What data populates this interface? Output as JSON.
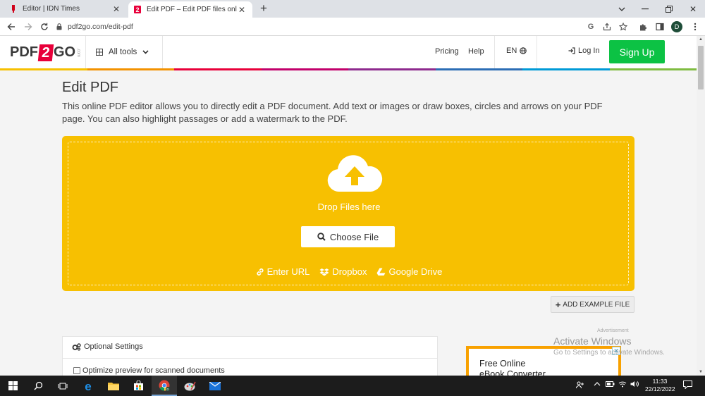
{
  "browser": {
    "tabs": [
      {
        "title": "Editor | IDN Times",
        "favicon": "idn-icon",
        "active": false
      },
      {
        "title": "Edit PDF – Edit PDF files online",
        "favicon": "pdf2go-icon",
        "active": true
      }
    ],
    "url": "pdf2go.com/edit-pdf",
    "profile_initial": "D",
    "google_glyph": "G"
  },
  "site": {
    "logo": {
      "pre": "PDF",
      "mid": "2",
      "post": "GO",
      "suffix": ".com"
    },
    "all_tools": "All tools",
    "nav": {
      "pricing": "Pricing",
      "help": "Help",
      "lang": "EN",
      "login": "Log In",
      "signup": "Sign Up"
    },
    "rainbow": [
      "#f7c001",
      "#f39200",
      "#e8003a",
      "#c2006b",
      "#8e2a8e",
      "#2c6db5",
      "#009ad7",
      "#7fbc41"
    ]
  },
  "main": {
    "title": "Edit PDF",
    "description": "This online PDF editor allows you to directly edit a PDF document. Add text or images or draw boxes, circles and arrows on your PDF page. You can also highlight passages or add a watermark to the PDF.",
    "dropzone": {
      "drop_text": "Drop Files here",
      "choose_file": "Choose File",
      "sources": {
        "url": "Enter URL",
        "dropbox": "Dropbox",
        "gdrive": "Google Drive"
      },
      "color": "#f7c001"
    },
    "example_file": "ADD EXAMPLE FILE",
    "optional_settings": {
      "title": "Optional Settings",
      "option1": "Optimize preview for scanned documents"
    }
  },
  "ad": {
    "label": "Advertisement",
    "text1": "Free Online",
    "text2": "eBook Converter",
    "close": "✕"
  },
  "watermark": {
    "line1": "Activate Windows",
    "line2": "Go to Settings to activate Windows."
  },
  "taskbar": {
    "time": "11:33",
    "date": "22/12/2022",
    "profile_badge": "D"
  }
}
